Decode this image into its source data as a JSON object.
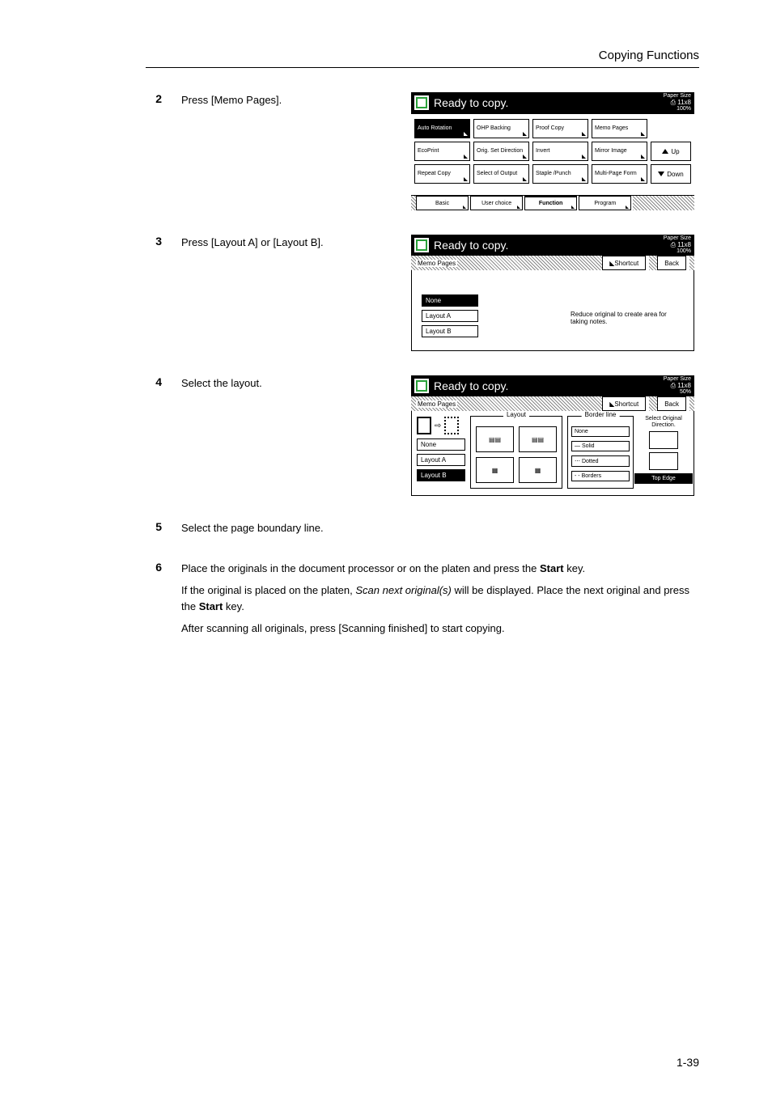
{
  "header": {
    "title": "Copying Functions"
  },
  "steps": {
    "s2": {
      "num": "2",
      "text": "Press [Memo Pages]."
    },
    "s3": {
      "num": "3",
      "text": "Press [Layout A] or [Layout B]."
    },
    "s4": {
      "num": "4",
      "text": "Select the layout."
    },
    "s5": {
      "num": "5",
      "text": "Select the page boundary line."
    },
    "s6": {
      "num": "6",
      "l1a": "Place the originals in the document processor or on the platen and press the ",
      "l1b": "Start",
      "l1c": " key.",
      "l2a": "If the original is placed on the platen, ",
      "l2b": "Scan next original(s)",
      "l2c": " will be displayed. Place the next original and press the ",
      "l2d": "Start",
      "l2e": " key.",
      "l3": "After scanning all originals, press [Scanning finished] to start copying."
    }
  },
  "screen1": {
    "title": "Ready to copy.",
    "paper": "Paper Size",
    "size": "11x8",
    "zoom": "100%",
    "rows": [
      [
        "Auto\nRotation",
        "OHP\nBacking",
        "Proof Copy",
        "Memo\nPages"
      ],
      [
        "EcoPrint",
        "Orig. Set\nDirection",
        "Invert",
        "Mirror\nImage"
      ],
      [
        "Repeat\nCopy",
        "Select of\nOutput",
        "Staple\n/Punch",
        "Multi-Page\nForm"
      ]
    ],
    "up": "Up",
    "down": "Down",
    "tabs": [
      "Basic",
      "User choice",
      "Function",
      "Program"
    ]
  },
  "screen2": {
    "title": "Ready to copy.",
    "paper": "Paper Size",
    "size": "11x8",
    "zoom": "100%",
    "bar": "Memo Pages",
    "shortcut": "Shortcut",
    "back": "Back",
    "opts": [
      "None",
      "Layout A",
      "Layout B"
    ],
    "hint": "Reduce original to create area for taking notes."
  },
  "screen3": {
    "title": "Ready to copy.",
    "paper": "Paper Size",
    "size": "11x8",
    "zoom": "50%",
    "bar": "Memo Pages",
    "shortcut": "Shortcut",
    "back": "Back",
    "left": [
      "None",
      "Layout A",
      "Layout B"
    ],
    "layout_caption": "Layout",
    "border_caption": "Border line",
    "border": [
      "None",
      "Solid",
      "Dotted",
      "Borders"
    ],
    "orig_hint": "Select Original Direction.",
    "top_edge": "Top Edge"
  },
  "page_number": "1-39"
}
